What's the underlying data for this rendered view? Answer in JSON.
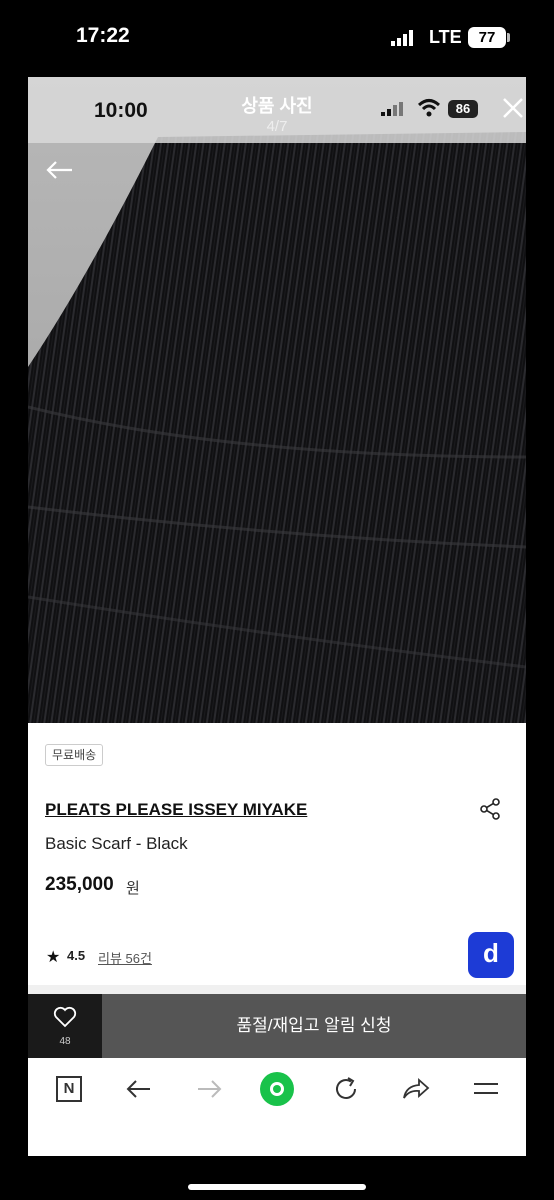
{
  "outer_status": {
    "time": "17:22",
    "network": "LTE",
    "battery": "77"
  },
  "inner_status": {
    "time": "10:00",
    "battery": "86"
  },
  "header": {
    "title": "상품 사진",
    "counter": "4/7"
  },
  "product": {
    "badge": "무료배송",
    "brand": "PLEATS PLEASE ISSEY MIYAKE",
    "name": "Basic Scarf - Black",
    "price": "235,000",
    "price_unit": "원",
    "rating": "4.5",
    "reviews": "리뷰 56건",
    "app_badge": "d"
  },
  "actions": {
    "wish_count": "48",
    "restock_label": "품절/재입고 알림 신청"
  },
  "toolbar": {
    "home_letter": "N"
  },
  "colors": {
    "accent_green": "#19c24a",
    "app_blue": "#1d3bd6"
  }
}
